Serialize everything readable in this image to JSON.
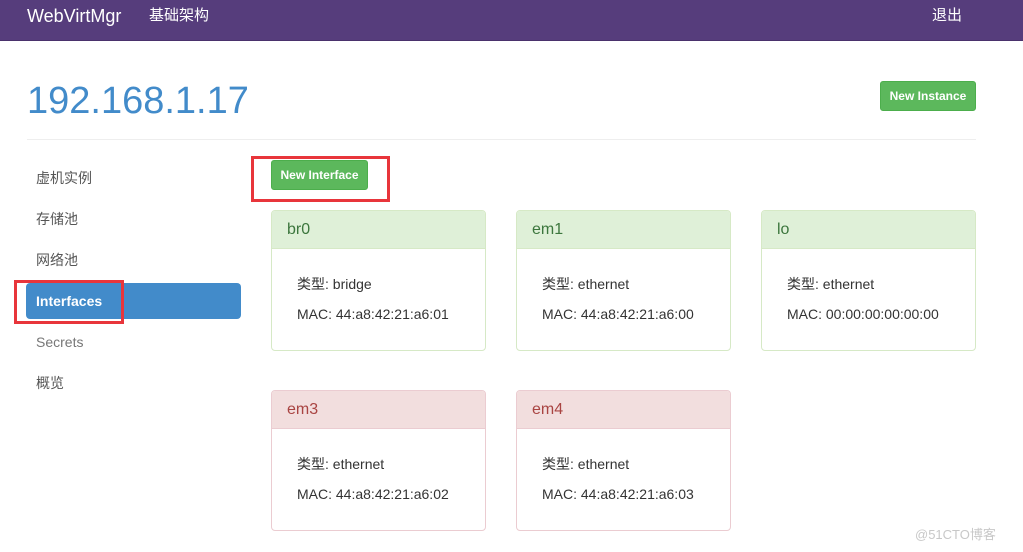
{
  "navbar": {
    "brand": "WebVirtMgr",
    "infrastructure_link": "基础架构",
    "logout_link": "退出",
    "background_color": "#563d7c"
  },
  "header": {
    "host_title": "192.168.1.17",
    "new_instance_label": "New Instance"
  },
  "sidebar": {
    "items": [
      {
        "label": "虚机实例",
        "active": false
      },
      {
        "label": "存储池",
        "active": false
      },
      {
        "label": "网络池",
        "active": false
      },
      {
        "label": "Interfaces",
        "active": true
      },
      {
        "label": "Secrets",
        "active": false
      },
      {
        "label": "概览",
        "active": false
      }
    ]
  },
  "main": {
    "new_interface_label": "New Interface",
    "type_prefix": "类型: ",
    "mac_prefix": "MAC: ",
    "interfaces": [
      {
        "name": "br0",
        "type": "bridge",
        "mac": "44:a8:42:21:a6:01",
        "state": "active"
      },
      {
        "name": "em1",
        "type": "ethernet",
        "mac": "44:a8:42:21:a6:00",
        "state": "active"
      },
      {
        "name": "lo",
        "type": "ethernet",
        "mac": "00:00:00:00:00:00",
        "state": "active"
      },
      {
        "name": "em3",
        "type": "ethernet",
        "mac": "44:a8:42:21:a6:02",
        "state": "inactive"
      },
      {
        "name": "em4",
        "type": "ethernet",
        "mac": "44:a8:42:21:a6:03",
        "state": "inactive"
      }
    ]
  },
  "colors": {
    "accent": "#428bca",
    "success_button": "#5cb85c",
    "highlight_box": "#e8353b"
  },
  "watermark": "@51CTO博客"
}
